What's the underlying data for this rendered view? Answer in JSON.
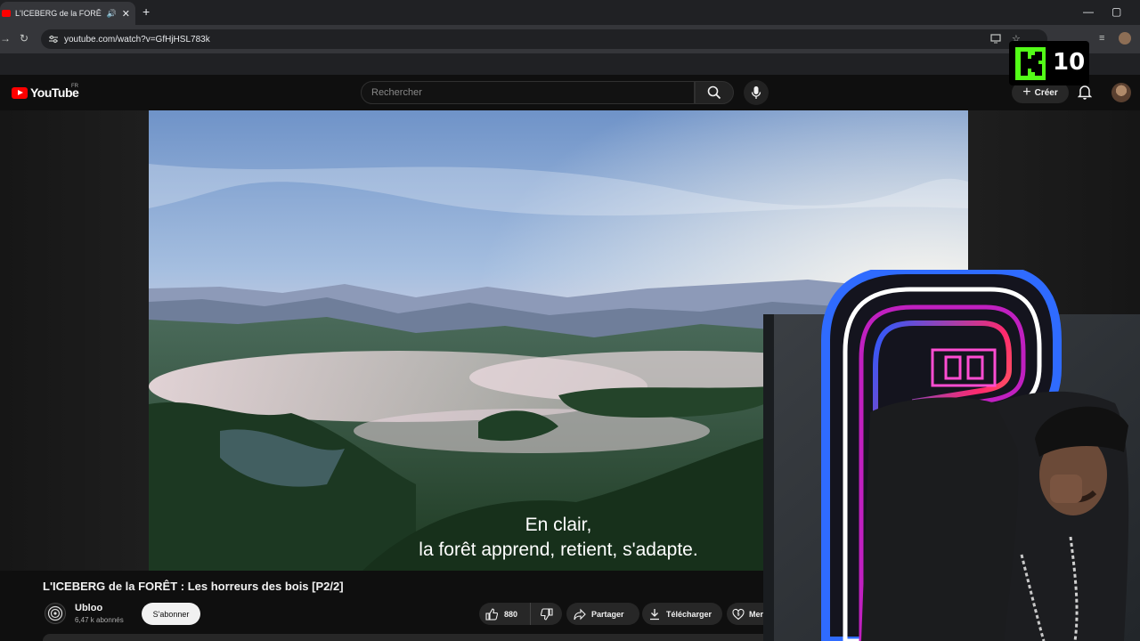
{
  "browser": {
    "tab_title": "L'ICEBERG de la FORÊT : Les",
    "new_tab": "+",
    "url": "youtube.com/watch?v=GfHjHSL783k",
    "minimize": "—",
    "restore": "▢"
  },
  "youtube": {
    "logo_text": "YouTube",
    "country_code": "FR",
    "search_placeholder": "Rechercher",
    "create_label": "Créer"
  },
  "video": {
    "subtitle_line1": "En clair,",
    "subtitle_line2": "la forêt apprend, retient, s'adapte.",
    "title": "L'ICEBERG de la FORÊT : Les horreurs des bois [P2/2]",
    "channel_name": "Ubloo",
    "subscribers": "6,47 k abonnés",
    "subscribe_label": "S'abonner",
    "likes": "880",
    "share_label": "Partager",
    "download_label": "Télécharger",
    "thanks_label": "Merci",
    "more_label": "···"
  },
  "overlay": {
    "kick_count": "10",
    "colors": {
      "kick_green": "#53fc18",
      "yt_red": "#ff0000"
    }
  }
}
